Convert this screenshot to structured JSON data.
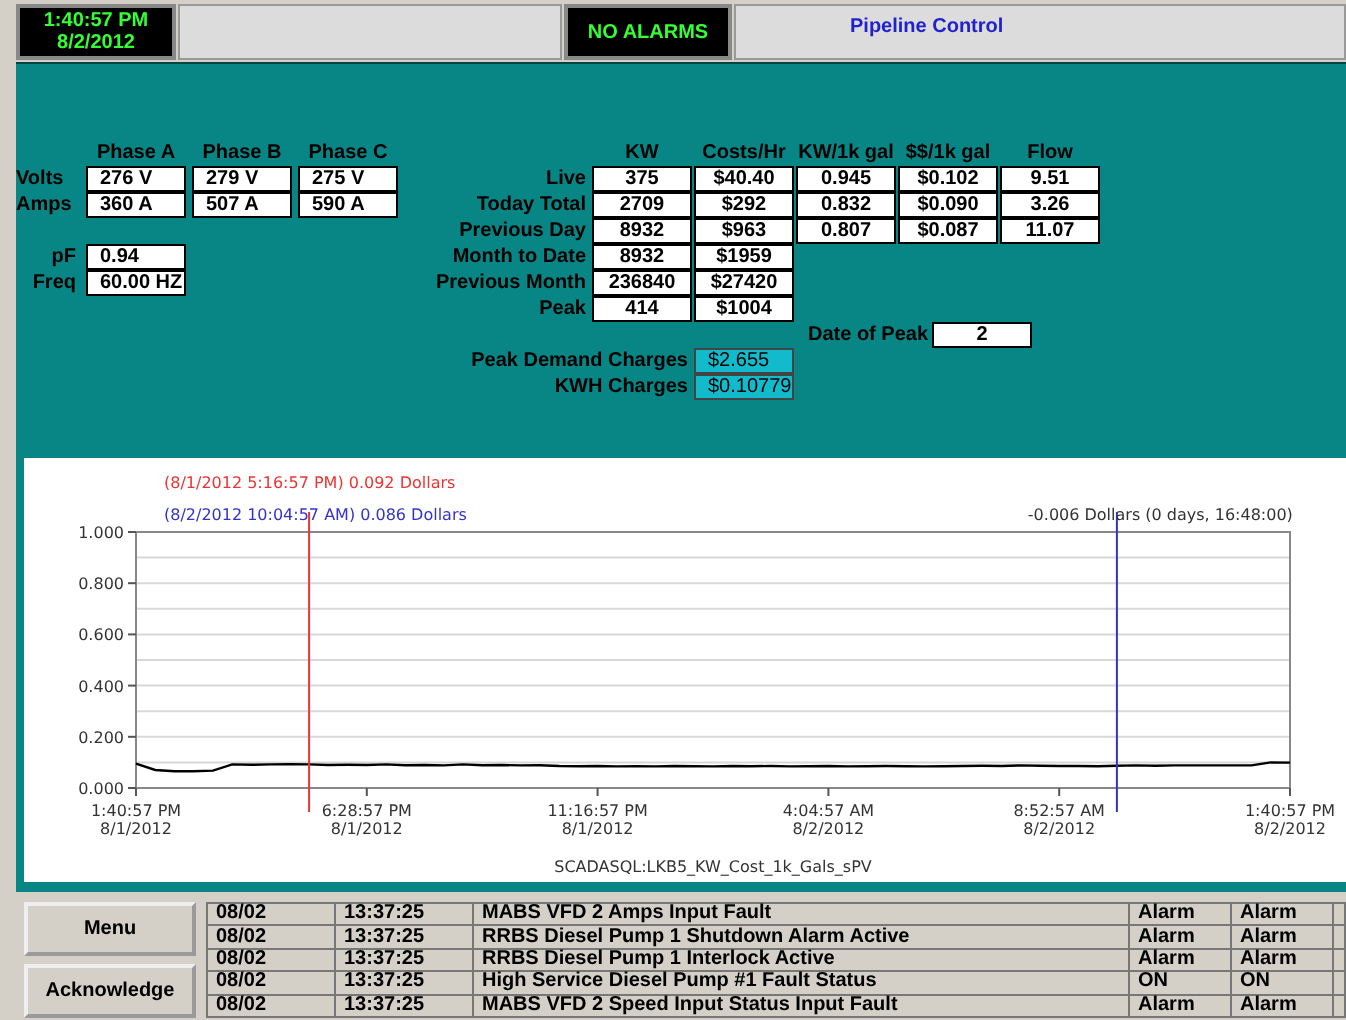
{
  "header": {
    "clock_time": "1:40:57 PM",
    "clock_date": "8/2/2012",
    "alarm_status": "NO ALARMS",
    "title": "Pipeline Control"
  },
  "electrical": {
    "columns": [
      "Phase A",
      "Phase B",
      "Phase C"
    ],
    "rows": [
      {
        "label": "Volts",
        "values": [
          "276 V",
          "279 V",
          "275 V"
        ]
      },
      {
        "label": "Amps",
        "values": [
          "360 A",
          "507 A",
          "590 A"
        ]
      }
    ],
    "extra": [
      {
        "label": "pF",
        "value": "0.94"
      },
      {
        "label": "Freq",
        "value": "60.00 HZ"
      }
    ]
  },
  "energy": {
    "columns": [
      "KW",
      "Costs/Hr",
      "KW/1k gal",
      "$$/1k gal",
      "Flow"
    ],
    "rows": [
      {
        "label": "Live",
        "values": [
          "375",
          "$40.40",
          "0.945",
          "$0.102",
          "9.51"
        ]
      },
      {
        "label": "Today Total",
        "values": [
          "2709",
          "$292",
          "0.832",
          "$0.090",
          "3.26"
        ]
      },
      {
        "label": "Previous Day",
        "values": [
          "8932",
          "$963",
          "0.807",
          "$0.087",
          "11.07"
        ]
      },
      {
        "label": "Month to Date",
        "values": [
          "8932",
          "$1959"
        ]
      },
      {
        "label": "Previous Month",
        "values": [
          "236840",
          "$27420"
        ]
      },
      {
        "label": "Peak",
        "values": [
          "414",
          "$1004"
        ]
      }
    ],
    "date_of_peak": {
      "label": "Date of Peak",
      "value": "2"
    },
    "charges": [
      {
        "label": "Peak Demand Charges",
        "value": "$2.655"
      },
      {
        "label": "KWH Charges",
        "value": "$0.10779"
      }
    ]
  },
  "trend": {
    "delta_label": "-0.006 Dollars (0 days, 16:48:00)",
    "cursors": [
      {
        "color": "#ee3333",
        "text": "(8/1/2012 5:16:57 PM) 0.092 Dollars"
      },
      {
        "color": "#3333cc",
        "text": "(8/2/2012 10:04:57 AM) 0.086 Dollars"
      }
    ],
    "chart_data": {
      "type": "line",
      "grid": true,
      "categories": [
        "1:40:57 PM\n8/1/2012",
        null,
        null,
        null,
        null,
        null,
        null,
        null,
        null,
        null,
        null,
        null,
        "6:28:57 PM\n8/1/2012",
        null,
        null,
        null,
        null,
        null,
        null,
        null,
        null,
        null,
        null,
        null,
        "11:16:57 PM\n8/1/2012",
        null,
        null,
        null,
        null,
        null,
        null,
        null,
        null,
        null,
        null,
        null,
        "4:04:57 AM\n8/2/2012",
        null,
        null,
        null,
        null,
        null,
        null,
        null,
        null,
        null,
        null,
        null,
        "8:52:57 AM\n8/2/2012",
        null,
        null,
        null,
        null,
        null,
        null,
        null,
        null,
        null,
        null,
        null,
        "1:40:57 PM\n8/2/2012"
      ],
      "series": [
        {
          "name": "SCADASQL:LKB5_KW_Cost_1k_Gals_sPV",
          "color": "#000000",
          "values": [
            0.095,
            0.07,
            0.066,
            0.066,
            0.068,
            0.092,
            0.091,
            0.092,
            0.093,
            0.092,
            0.09,
            0.091,
            0.09,
            0.092,
            0.089,
            0.09,
            0.088,
            0.092,
            0.089,
            0.09,
            0.088,
            0.089,
            0.086,
            0.085,
            0.086,
            0.084,
            0.085,
            0.084,
            0.086,
            0.085,
            0.084,
            0.086,
            0.085,
            0.086,
            0.084,
            0.085,
            0.086,
            0.084,
            0.085,
            0.086,
            0.085,
            0.084,
            0.085,
            0.086,
            0.087,
            0.086,
            0.088,
            0.087,
            0.086,
            0.086,
            0.085,
            0.087,
            0.088,
            0.087,
            0.088,
            0.088,
            0.088,
            0.088,
            0.088,
            0.1,
            0.099
          ]
        }
      ],
      "ylim": [
        0,
        1
      ],
      "yticks": [
        {
          "value": 0,
          "label": "0.000"
        },
        {
          "value": 0.2,
          "label": "0.200"
        },
        {
          "value": 0.4,
          "label": "0.400"
        },
        {
          "value": 0.6,
          "label": "0.600"
        },
        {
          "value": 0.8,
          "label": "0.800"
        },
        {
          "value": 1,
          "label": "1.000"
        }
      ]
    }
  },
  "buttons": [
    "Menu",
    "Acknowledge"
  ],
  "alarms": {
    "rows": [
      {
        "cells": [
          "08/02",
          "13:37:25",
          "MABS VFD 2 Amps Input Fault",
          "Alarm",
          "Alarm"
        ]
      },
      {
        "cells": [
          "08/02",
          "13:37:25",
          "RRBS Diesel Pump 1 Shutdown Alarm Active",
          "Alarm",
          "Alarm"
        ]
      },
      {
        "cells": [
          "08/02",
          "13:37:25",
          "RRBS Diesel Pump 1 Interlock Active",
          "Alarm",
          "Alarm"
        ]
      },
      {
        "cells": [
          "08/02",
          "13:37:25",
          "High Service Diesel Pump #1 Fault Status",
          "ON",
          "ON"
        ]
      },
      {
        "cells": [
          "08/02",
          "13:37:25",
          "MABS VFD 2 Speed Input Status Input Fault",
          "Alarm",
          "Alarm"
        ]
      }
    ]
  }
}
